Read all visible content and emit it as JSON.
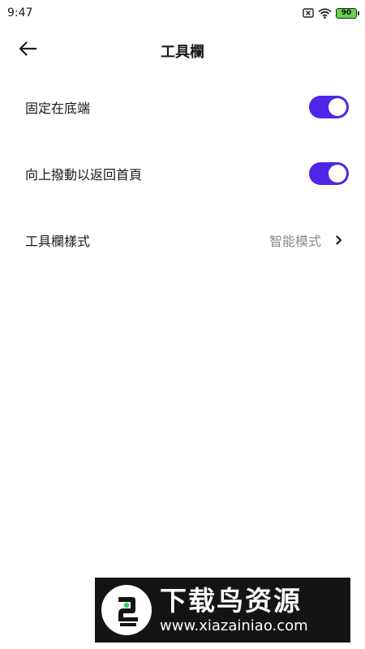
{
  "status_bar": {
    "time": "9:47",
    "battery": "90",
    "icons": [
      "sim-off-icon",
      "wifi-icon",
      "battery-icon"
    ],
    "battery_color": "#6ad24c"
  },
  "header": {
    "title": "工具欄",
    "back_icon": "arrow-left-icon"
  },
  "settings": {
    "pin_bottom": {
      "label": "固定在底端",
      "enabled": true
    },
    "swipe_up_home": {
      "label": "向上撥動以返回首頁",
      "enabled": true
    },
    "toolbar_style": {
      "label": "工具欄樣式",
      "value": "智能模式",
      "icon": "chevron-right-icon"
    }
  },
  "colors": {
    "toggle_on": "#4f26e6",
    "value_text": "#8a8a8a"
  },
  "watermark": {
    "title": "下载鸟资源",
    "url": "www.xiazainiao.com"
  }
}
